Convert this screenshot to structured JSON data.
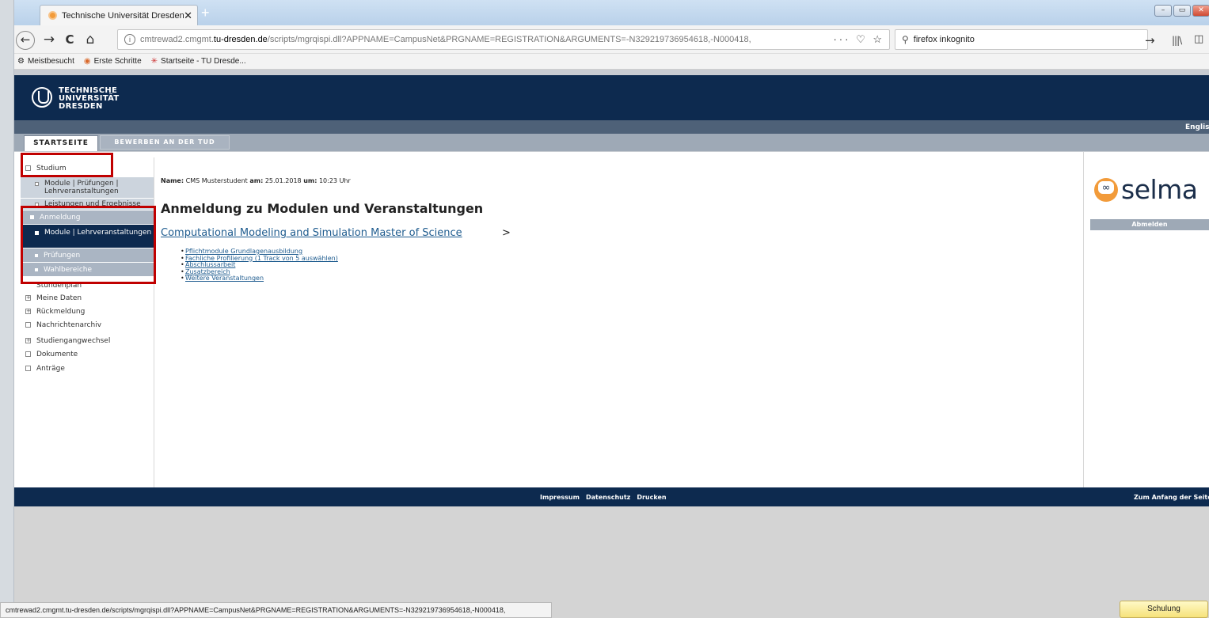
{
  "browser": {
    "tab_title": "Technische Universität Dresden",
    "tab_close": "✕",
    "new_tab": "+",
    "window_buttons": {
      "minimize": "–",
      "maximize": "▭",
      "close": "✕"
    },
    "nav": {
      "back": "←",
      "forward": "→",
      "reload": "C",
      "home": "⌂"
    },
    "url_prefix": "cmtrewad2.cmgmt.",
    "url_host": "tu-dresden.de",
    "url_path": "/scripts/mgrqispi.dll?APPNAME=CampusNet&PRGNAME=REGISTRATION&ARGUMENTS=-N329219736954618,-N000418,",
    "url_actions": "··· ♡ ☆",
    "search_value": "firefox inkognito",
    "search_icon": "⚲",
    "search_go": "→",
    "library_icon": "|||\\",
    "sidebar_icon": "◫",
    "menu_icon": "≡",
    "bookmarks": [
      {
        "icon": "gear-icon",
        "glyph": "⚙",
        "label": "Meistbesucht"
      },
      {
        "icon": "firefox-icon",
        "glyph": "◉",
        "label": "Erste Schritte"
      },
      {
        "icon": "tu-icon",
        "glyph": "✳",
        "label": "Startseite - TU Dresde..."
      }
    ],
    "status_url": "cmtrewad2.cmgmt.tu-dresden.de/scripts/mgrqispi.dll?APPNAME=CampusNet&PRGNAME=REGISTRATION&ARGUMENTS=-N329219736954618,-N000418,"
  },
  "site": {
    "logo_lines": [
      "TECHNISCHE",
      "UNIVERSITÄT",
      "DRESDEN"
    ],
    "language_link": "Englis",
    "top_tabs": [
      "STARTSEITE",
      "BEWERBEN AN DER TUD"
    ],
    "sidebar": {
      "studium": "Studium",
      "module_pruefungen": "Module | Prüfungen | Lehrveranstaltungen",
      "leistungen": "Leistungen und Ergebnisse",
      "anmeldung": "Anmeldung",
      "anm_module": "Module | Lehrveranstaltungen",
      "anm_pruefungen": "Prüfungen",
      "anm_wahlbereiche": "Wahlbereiche",
      "stundenplan": "Stundenplan",
      "meine_daten": "Meine Daten",
      "rueckmeldung": "Rückmeldung",
      "nachrichtenarchiv": "Nachrichtenarchiv",
      "studiengangwechsel": "Studiengangwechsel",
      "dokumente": "Dokumente",
      "antraege": "Anträge"
    },
    "content": {
      "name_label": "Name:",
      "name_value": "CMS Musterstudent",
      "am_label": "am:",
      "date": "25.01.2018",
      "um_label": "um:",
      "time": "10:23 Uhr",
      "title": "Anmeldung zu Modulen und Veranstaltungen",
      "program": "Computational Modeling and Simulation Master of Science",
      "program_chevron": ">",
      "links": [
        "Pflichtmodule Grundlagenausbildung",
        "Fachliche Profilierung (1 Track von 5 auswählen)",
        "Abschlussarbeit",
        "Zusatzbereich",
        "Weitere Veranstaltungen"
      ]
    },
    "selma_logo": "selma",
    "logout": "Abmelden",
    "footer": {
      "impressum": "Impressum",
      "datenschutz": "Datenschutz",
      "drucken": "Drucken",
      "top": "Zum Anfang der Seite"
    }
  },
  "schulung_button": "Schulung",
  "colors": {
    "navy": "#0d2a4f",
    "highlight": "#c00000",
    "link": "#1f5c8f",
    "selma_orange": "#f29b3a"
  }
}
